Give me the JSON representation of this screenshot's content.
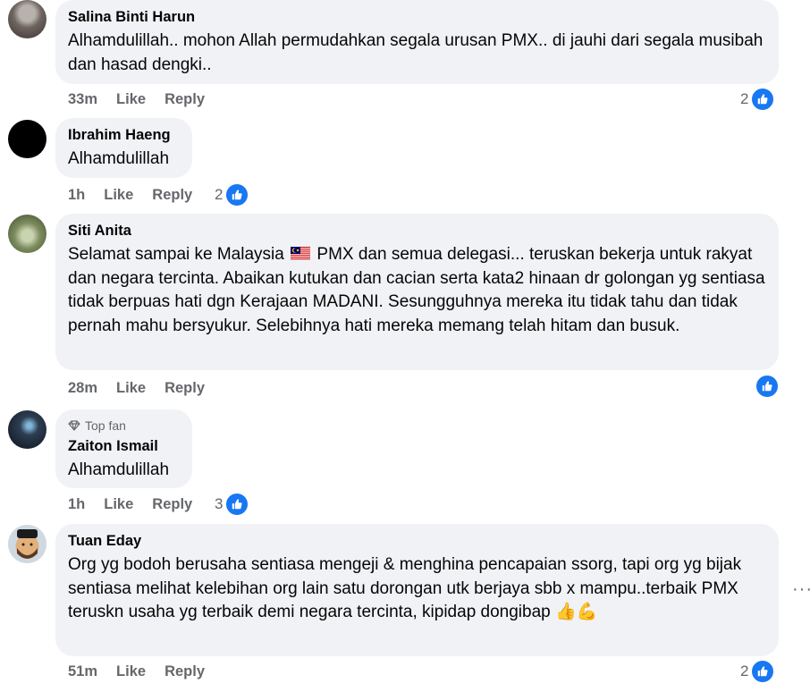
{
  "comments": [
    {
      "name": "Salina Binti Harun",
      "text": "Alhamdulillah.. mohon Allah permudahkan segala urusan PMX.. di jauhi dari segala musibah dan hasad dengki..",
      "time": "33m",
      "like": "Like",
      "reply": "Reply",
      "reaction_count": "2"
    },
    {
      "name": "Ibrahim Haeng",
      "text": "Alhamdulillah",
      "time": "1h",
      "like": "Like",
      "reply": "Reply",
      "reaction_count": "2"
    },
    {
      "name": "Siti Anita",
      "text_before_flag": "Selamat sampai ke Malaysia",
      "text_after_flag": "PMX dan semua delegasi... teruskan bekerja untuk rakyat dan negara tercinta. Abaikan kutukan dan cacian serta kata2 hinaan dr golongan yg sentiasa tidak berpuas hati dgn Kerajaan MADANI. Sesungguhnya mereka itu tidak tahu dan tidak pernah mahu bersyukur. Selebihnya hati mereka memang telah hitam dan busuk.",
      "time": "28m",
      "like": "Like",
      "reply": "Reply",
      "reaction_count": ""
    },
    {
      "badge": "Top fan",
      "name": "Zaiton Ismail",
      "text": "Alhamdulillah",
      "time": "1h",
      "like": "Like",
      "reply": "Reply",
      "reaction_count": "3"
    },
    {
      "name": "Tuan Eday",
      "text": "Org yg bodoh berusaha sentiasa mengeji & menghina pencapaian ssorg, tapi org yg bijak sentiasa melihat kelebihan org lain satu dorongan utk berjaya sbb x mampu..terbaik PMX teruskn usaha yg terbaik demi negara tercinta, kipidap dongibap",
      "emoji": "👍💪",
      "time": "51m",
      "like": "Like",
      "reply": "Reply",
      "reaction_count": "2"
    }
  ],
  "more_options": "···",
  "colors": {
    "bubble": "#f0f2f5",
    "like_blue": "#1877f2",
    "meta_gray": "#65676b"
  },
  "icons": [
    "like-icon",
    "top-fan-diamond-icon",
    "malaysia-flag-icon",
    "more-options-icon"
  ]
}
